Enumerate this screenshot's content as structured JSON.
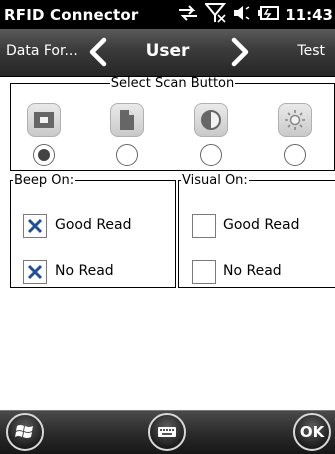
{
  "status_bar": {
    "app_title": "RFID Connector",
    "time": "11:43",
    "icons": [
      "connectivity-icon",
      "signal-off-icon",
      "volume-icon",
      "battery-icon"
    ]
  },
  "nav": {
    "prev_label": "Data For...",
    "title": "User",
    "next_label": "Test"
  },
  "scan_group": {
    "legend": "Select Scan Button",
    "buttons": [
      {
        "icon": "square-button-icon",
        "selected": true
      },
      {
        "icon": "document-icon",
        "selected": false
      },
      {
        "icon": "contrast-icon",
        "selected": false
      },
      {
        "icon": "brightness-icon",
        "selected": false
      }
    ]
  },
  "beep_group": {
    "legend": "Beep On:",
    "good_read": {
      "label": "Good Read",
      "checked": true
    },
    "no_read": {
      "label": "No Read",
      "checked": true
    }
  },
  "visual_group": {
    "legend": "Visual On:",
    "good_read": {
      "label": "Good Read",
      "checked": false
    },
    "no_read": {
      "label": "No Read",
      "checked": false
    }
  },
  "bottom_bar": {
    "start_icon": "windows-start-icon",
    "keyboard_icon": "keyboard-icon",
    "ok_label": "OK"
  },
  "colors": {
    "check_mark": "#1f4e9a",
    "radio_selected": "#444444"
  }
}
